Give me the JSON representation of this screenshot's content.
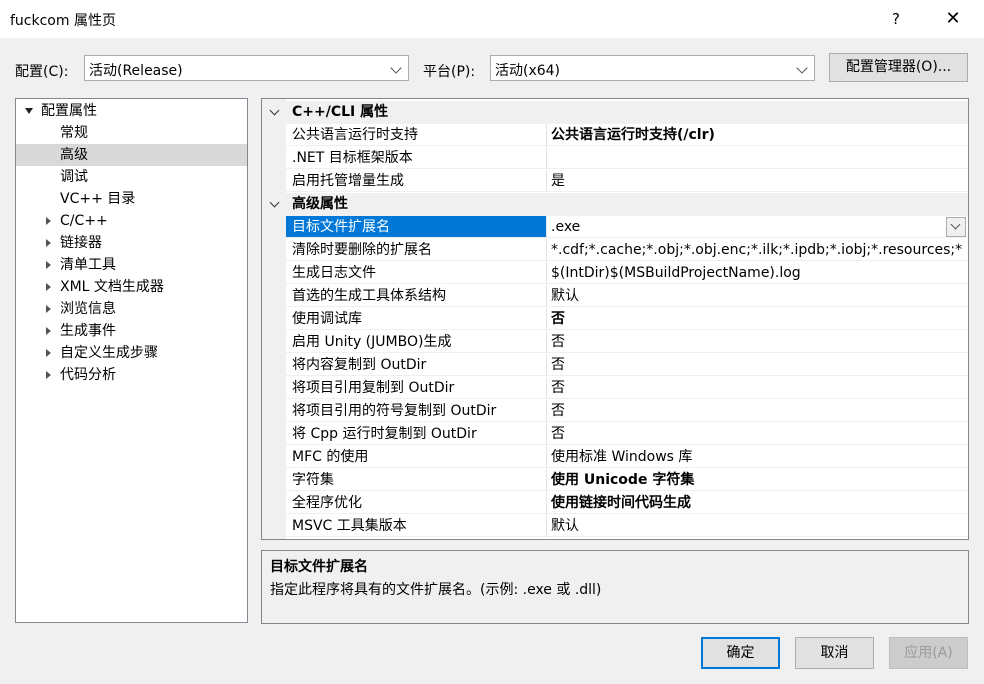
{
  "window": {
    "title": "fuckcom 属性页",
    "help_label": "?",
    "close_label": "✕"
  },
  "toolbar": {
    "config_label": "配置(C):",
    "config_value": "活动(Release)",
    "platform_label": "平台(P):",
    "platform_value": "活动(x64)",
    "config_manager_label": "配置管理器(O)..."
  },
  "tree": {
    "root": "配置属性",
    "items": [
      {
        "label": "常规"
      },
      {
        "label": "高级"
      },
      {
        "label": "调试"
      },
      {
        "label": "VC++ 目录"
      },
      {
        "label": "C/C++"
      },
      {
        "label": "链接器"
      },
      {
        "label": "清单工具"
      },
      {
        "label": "XML 文档生成器"
      },
      {
        "label": "浏览信息"
      },
      {
        "label": "生成事件"
      },
      {
        "label": "自定义生成步骤"
      },
      {
        "label": "代码分析"
      }
    ]
  },
  "grid": {
    "categories": [
      {
        "title": "C++/CLI 属性",
        "rows": [
          {
            "name": "公共语言运行时支持",
            "value": "公共语言运行时支持(/clr)"
          },
          {
            "name": ".NET 目标框架版本",
            "value": ""
          },
          {
            "name": "启用托管增量生成",
            "value": "是"
          }
        ]
      },
      {
        "title": "高级属性",
        "rows": [
          {
            "name": "目标文件扩展名",
            "value": ".exe"
          },
          {
            "name": "清除时要删除的扩展名",
            "value": "*.cdf;*.cache;*.obj;*.obj.enc;*.ilk;*.ipdb;*.iobj;*.resources;*"
          },
          {
            "name": "生成日志文件",
            "value": "$(IntDir)$(MSBuildProjectName).log"
          },
          {
            "name": "首选的生成工具体系结构",
            "value": "默认"
          },
          {
            "name": "使用调试库",
            "value": "否"
          },
          {
            "name": "启用 Unity (JUMBO)生成",
            "value": "否"
          },
          {
            "name": "将内容复制到 OutDir",
            "value": "否"
          },
          {
            "name": "将项目引用复制到 OutDir",
            "value": "否"
          },
          {
            "name": "将项目引用的符号复制到 OutDir",
            "value": "否"
          },
          {
            "name": "将 Cpp 运行时复制到 OutDir",
            "value": "否"
          },
          {
            "name": "MFC 的使用",
            "value": "使用标准 Windows 库"
          },
          {
            "name": "字符集",
            "value": "使用 Unicode 字符集"
          },
          {
            "name": "全程序优化",
            "value": "使用链接时间代码生成"
          },
          {
            "name": "MSVC 工具集版本",
            "value": "默认"
          }
        ]
      }
    ]
  },
  "description": {
    "title": "目标文件扩展名",
    "text": "指定此程序将具有的文件扩展名。(示例: .exe 或 .dll)"
  },
  "buttons": {
    "ok": "确定",
    "cancel": "取消",
    "apply": "应用(A)"
  }
}
